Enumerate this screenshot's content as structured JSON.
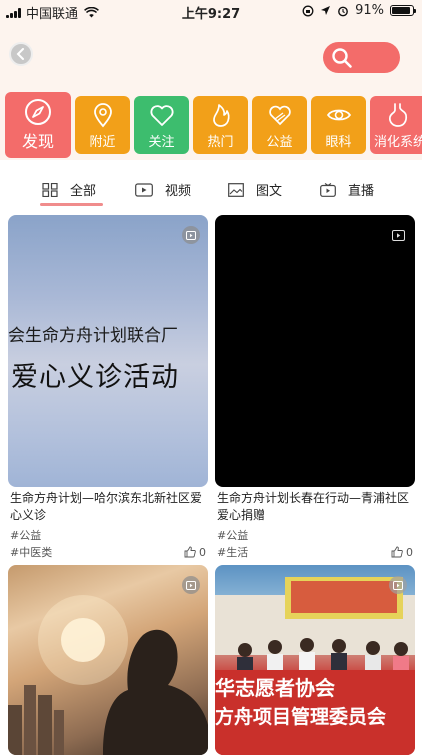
{
  "status_bar": {
    "carrier": "中国联通",
    "time": "上午9:27",
    "battery_percent": "91%",
    "battery_level": 0.91
  },
  "categories": [
    {
      "label": "发现",
      "icon": "compass-icon",
      "color": "#f36c6a",
      "active": true
    },
    {
      "label": "附近",
      "icon": "location-pin-icon",
      "color": "#f2a019",
      "active": false
    },
    {
      "label": "关注",
      "icon": "heart-icon",
      "color": "#3dbd6e",
      "active": false
    },
    {
      "label": "热门",
      "icon": "flame-icon",
      "color": "#f2a019",
      "active": false
    },
    {
      "label": "公益",
      "icon": "charity-heart-icon",
      "color": "#f2a019",
      "active": false
    },
    {
      "label": "眼科",
      "icon": "eye-icon",
      "color": "#f2a019",
      "active": false
    },
    {
      "label": "消化系统",
      "icon": "stomach-icon",
      "color": "#f36c6a",
      "active": false
    }
  ],
  "filters": [
    {
      "label": "全部",
      "icon": "grid-icon",
      "selected": true
    },
    {
      "label": "视频",
      "icon": "video-icon",
      "selected": false
    },
    {
      "label": "图文",
      "icon": "image-text-icon",
      "selected": false
    },
    {
      "label": "直播",
      "icon": "live-tv-icon",
      "selected": false
    }
  ],
  "posts": [
    {
      "overlay_line1": "会生命方舟计划联合厂",
      "overlay_line2": "爱心义诊活动",
      "title": "生命方舟计划—哈尔滨东北新社区爱心义诊",
      "tag1": "#公益",
      "tag2": "#中医类",
      "likes": "0"
    },
    {
      "title": "生命方舟计划长春在行动—青浦社区爱心捐赠",
      "tag1": "#公益",
      "tag2": "#生活",
      "likes": "0"
    },
    {},
    {
      "banner_text_1": "华志愿者协会",
      "banner_text_2": "方舟项目管理委员会"
    }
  ]
}
